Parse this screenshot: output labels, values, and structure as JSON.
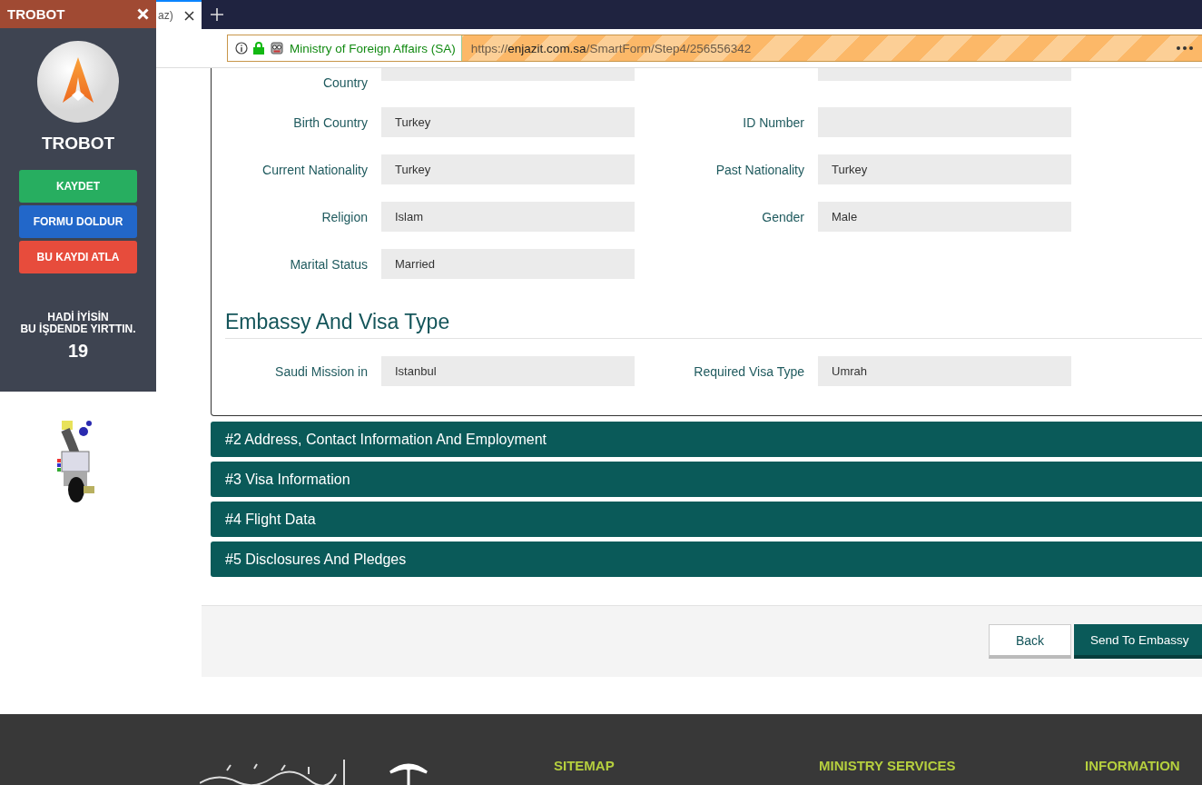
{
  "browser": {
    "tab": {
      "title": "az)",
      "selected": true
    },
    "address": {
      "site": "Ministry of Foreign Affairs (SA)",
      "scheme": "https://",
      "host": "enjazit.com.sa",
      "path": "/SmartForm/Step4/256556342"
    }
  },
  "trobot": {
    "title": "TROBOT",
    "brand": "TROBOT",
    "buttons": [
      {
        "label": "KAYDET",
        "color": "#27ae60"
      },
      {
        "label": "FORMU DOLDUR",
        "color": "#2267c9"
      },
      {
        "label": "BU KAYDI ATLA",
        "color": "#e74c3c"
      }
    ],
    "message": [
      "HADİ İYİSİN",
      "BU İŞDENDE YIRTTIN."
    ],
    "count": "19"
  },
  "form": {
    "top_label": "Country",
    "rows": [
      [
        {
          "label": "Birth Country",
          "value": "Turkey"
        },
        {
          "label": "ID Number"
        }
      ],
      [
        {
          "label": "Current Nationality",
          "value": "Turkey"
        },
        {
          "label": "Past Nationality",
          "value": "Turkey"
        }
      ],
      [
        {
          "label": "Religion",
          "value": "Islam"
        },
        {
          "label": "Gender",
          "value": "Male"
        }
      ],
      [
        {
          "label": "Marital Status",
          "value": "Married"
        }
      ]
    ],
    "section": {
      "title": "Embassy And Visa Type",
      "rows": [
        [
          {
            "label": "Saudi Mission in",
            "value": "Istanbul"
          },
          {
            "label": "Required Visa Type",
            "value": "Umrah"
          }
        ]
      ]
    }
  },
  "accordions": [
    "#2 Address, Contact Information And Employment",
    "#3 Visa Information",
    "#4 Flight Data",
    "#5 Disclosures And Pledges"
  ],
  "actions": [
    {
      "label": "Back",
      "kind": "secondary"
    },
    {
      "label": "Send To Embassy",
      "kind": "primary"
    }
  ],
  "footer": {
    "headings": [
      "SITEMAP",
      "MINISTRY SERVICES",
      "INFORMATION"
    ]
  }
}
